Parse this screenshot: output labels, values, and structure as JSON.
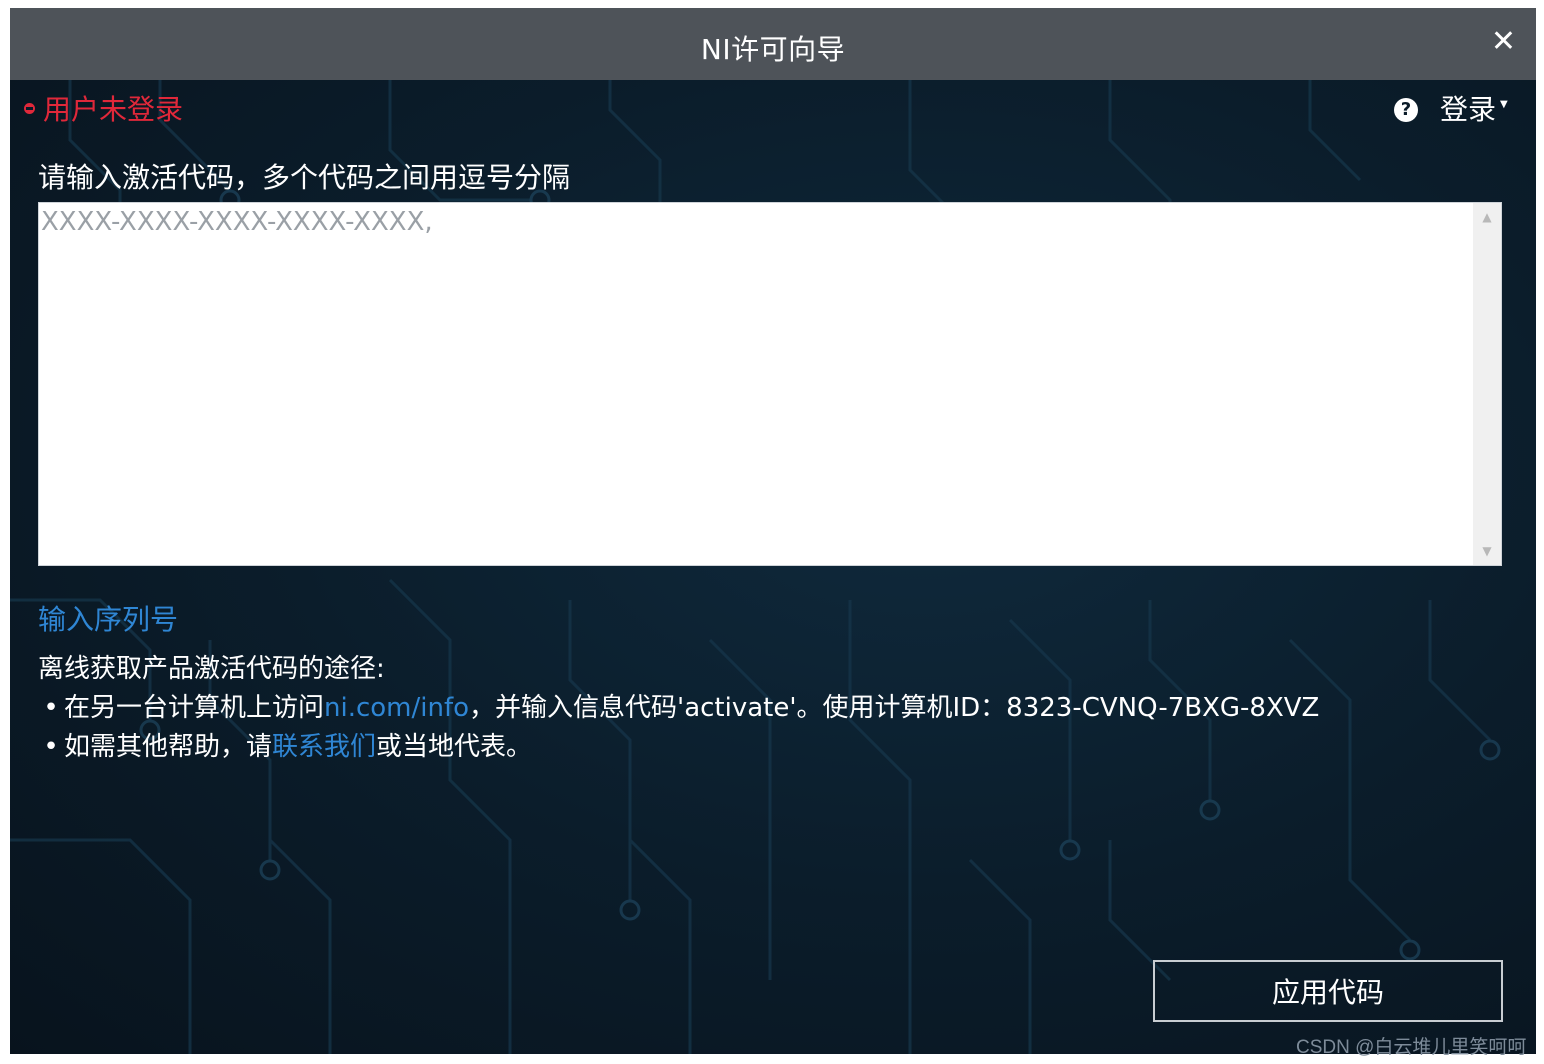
{
  "window": {
    "title": "NI许可向导",
    "close_icon": "close-icon"
  },
  "header": {
    "status_text": "用户未登录",
    "status_color": "#e0283a",
    "help_icon": "question-circle-icon",
    "login_label": "登录"
  },
  "activation": {
    "prompt": "请输入激活代码，多个代码之间用逗号分隔",
    "code_value": "",
    "code_placeholder": "XXXX-XXXX-XXXX-XXXX-XXXX,"
  },
  "serial_link": "输入序列号",
  "offline": {
    "heading": "离线获取产品激活代码的途径:",
    "line1_prefix": "在另一台计算机上访问",
    "line1_link": "ni.com/info",
    "line1_suffix": "，并输入信息代码'activate'。使用计算机ID：8323-CVNQ-7BXG-8XVZ",
    "line2_prefix": "如需其他帮助，请",
    "line2_link": "联系我们",
    "line2_suffix": "或当地代表。"
  },
  "apply_button": "应用代码",
  "watermark": "CSDN @白云堆儿里笑呵呵",
  "colors": {
    "titlebar": "#4e5359",
    "background": "#0a1a28",
    "link": "#2f86d4"
  }
}
